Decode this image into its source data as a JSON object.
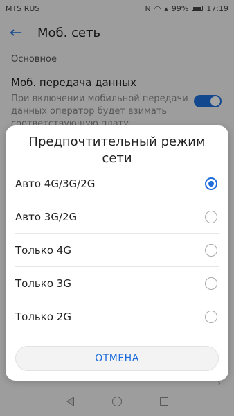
{
  "status": {
    "carrier": "MTS RUS",
    "battery": "99%",
    "time": "17:19"
  },
  "app_bar": {
    "title": "Моб. сеть"
  },
  "section": {
    "header": "Основное"
  },
  "setting": {
    "title": "Моб. передача данных",
    "description": "При включении мобильной передачи данных оператор будет взимать соответствующую плату",
    "enabled": true
  },
  "dialog": {
    "title": "Предпочтительный режим сети",
    "options": [
      {
        "label": "Авто 4G/3G/2G",
        "selected": true
      },
      {
        "label": "Авто 3G/2G",
        "selected": false
      },
      {
        "label": "Только 4G",
        "selected": false
      },
      {
        "label": "Только 3G",
        "selected": false
      },
      {
        "label": "Только 2G",
        "selected": false
      }
    ],
    "cancel_label": "ОТМЕНА"
  },
  "colors": {
    "accent": "#1e6ddb",
    "background": "#f2f2f2",
    "dialog": "#ffffff"
  },
  "icons": {
    "back": "arrow-left-icon",
    "nfc": "nfc-icon",
    "wifi": "wifi-icon",
    "battery": "battery-icon"
  }
}
